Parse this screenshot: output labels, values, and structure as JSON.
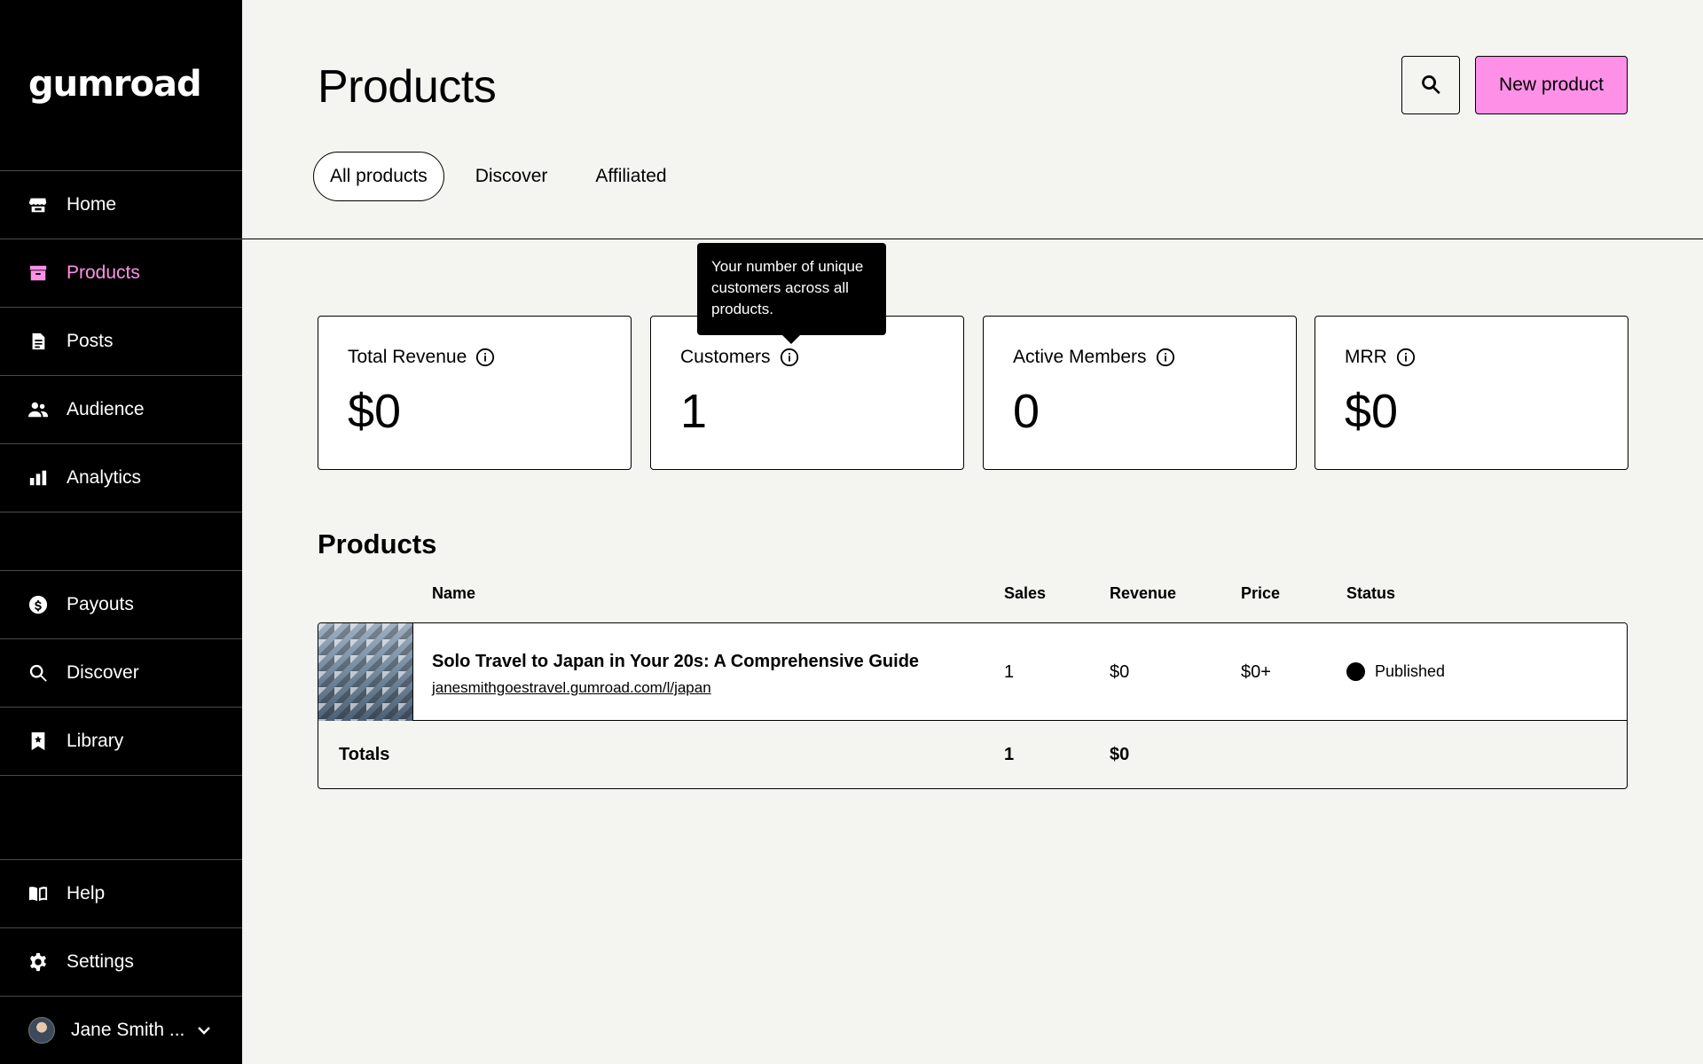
{
  "brand": {
    "logo_text": "gumroad"
  },
  "sidebar": {
    "items": [
      {
        "label": "Home",
        "icon": "store-icon"
      },
      {
        "label": "Products",
        "icon": "archive-icon",
        "active": true
      },
      {
        "label": "Posts",
        "icon": "document-icon"
      },
      {
        "label": "Audience",
        "icon": "people-icon"
      },
      {
        "label": "Analytics",
        "icon": "bar-chart-icon"
      },
      {
        "label": "Payouts",
        "icon": "dollar-circle-icon"
      },
      {
        "label": "Discover",
        "icon": "search-icon"
      },
      {
        "label": "Library",
        "icon": "bookmark-icon"
      },
      {
        "label": "Help",
        "icon": "book-icon"
      },
      {
        "label": "Settings",
        "icon": "gear-icon"
      }
    ],
    "user": {
      "name": "Jane Smith ...",
      "icon": "chevron-down-icon"
    }
  },
  "header": {
    "title": "Products",
    "new_button_label": "New product",
    "accent_color": "#ff90e8",
    "tabs": [
      {
        "label": "All products",
        "active": true
      },
      {
        "label": "Discover"
      },
      {
        "label": "Affiliated"
      }
    ]
  },
  "stats": [
    {
      "label": "Total Revenue",
      "value": "$0"
    },
    {
      "label": "Customers",
      "value": "1"
    },
    {
      "label": "Active Members",
      "value": "0"
    },
    {
      "label": "MRR",
      "value": "$0"
    }
  ],
  "tooltip": {
    "text": "Your number of unique customers across all products."
  },
  "products": {
    "title": "Products",
    "columns": {
      "name": "Name",
      "sales": "Sales",
      "revenue": "Revenue",
      "price": "Price",
      "status": "Status"
    },
    "rows": [
      {
        "name": "Solo Travel to Japan in Your 20s: A Comprehensive Guide",
        "url": "janesmithgoestravel.gumroad.com/l/japan",
        "sales": "1",
        "revenue": "$0",
        "price": "$0+",
        "status": "Published"
      }
    ],
    "totals": {
      "label": "Totals",
      "sales": "1",
      "revenue": "$0"
    }
  }
}
